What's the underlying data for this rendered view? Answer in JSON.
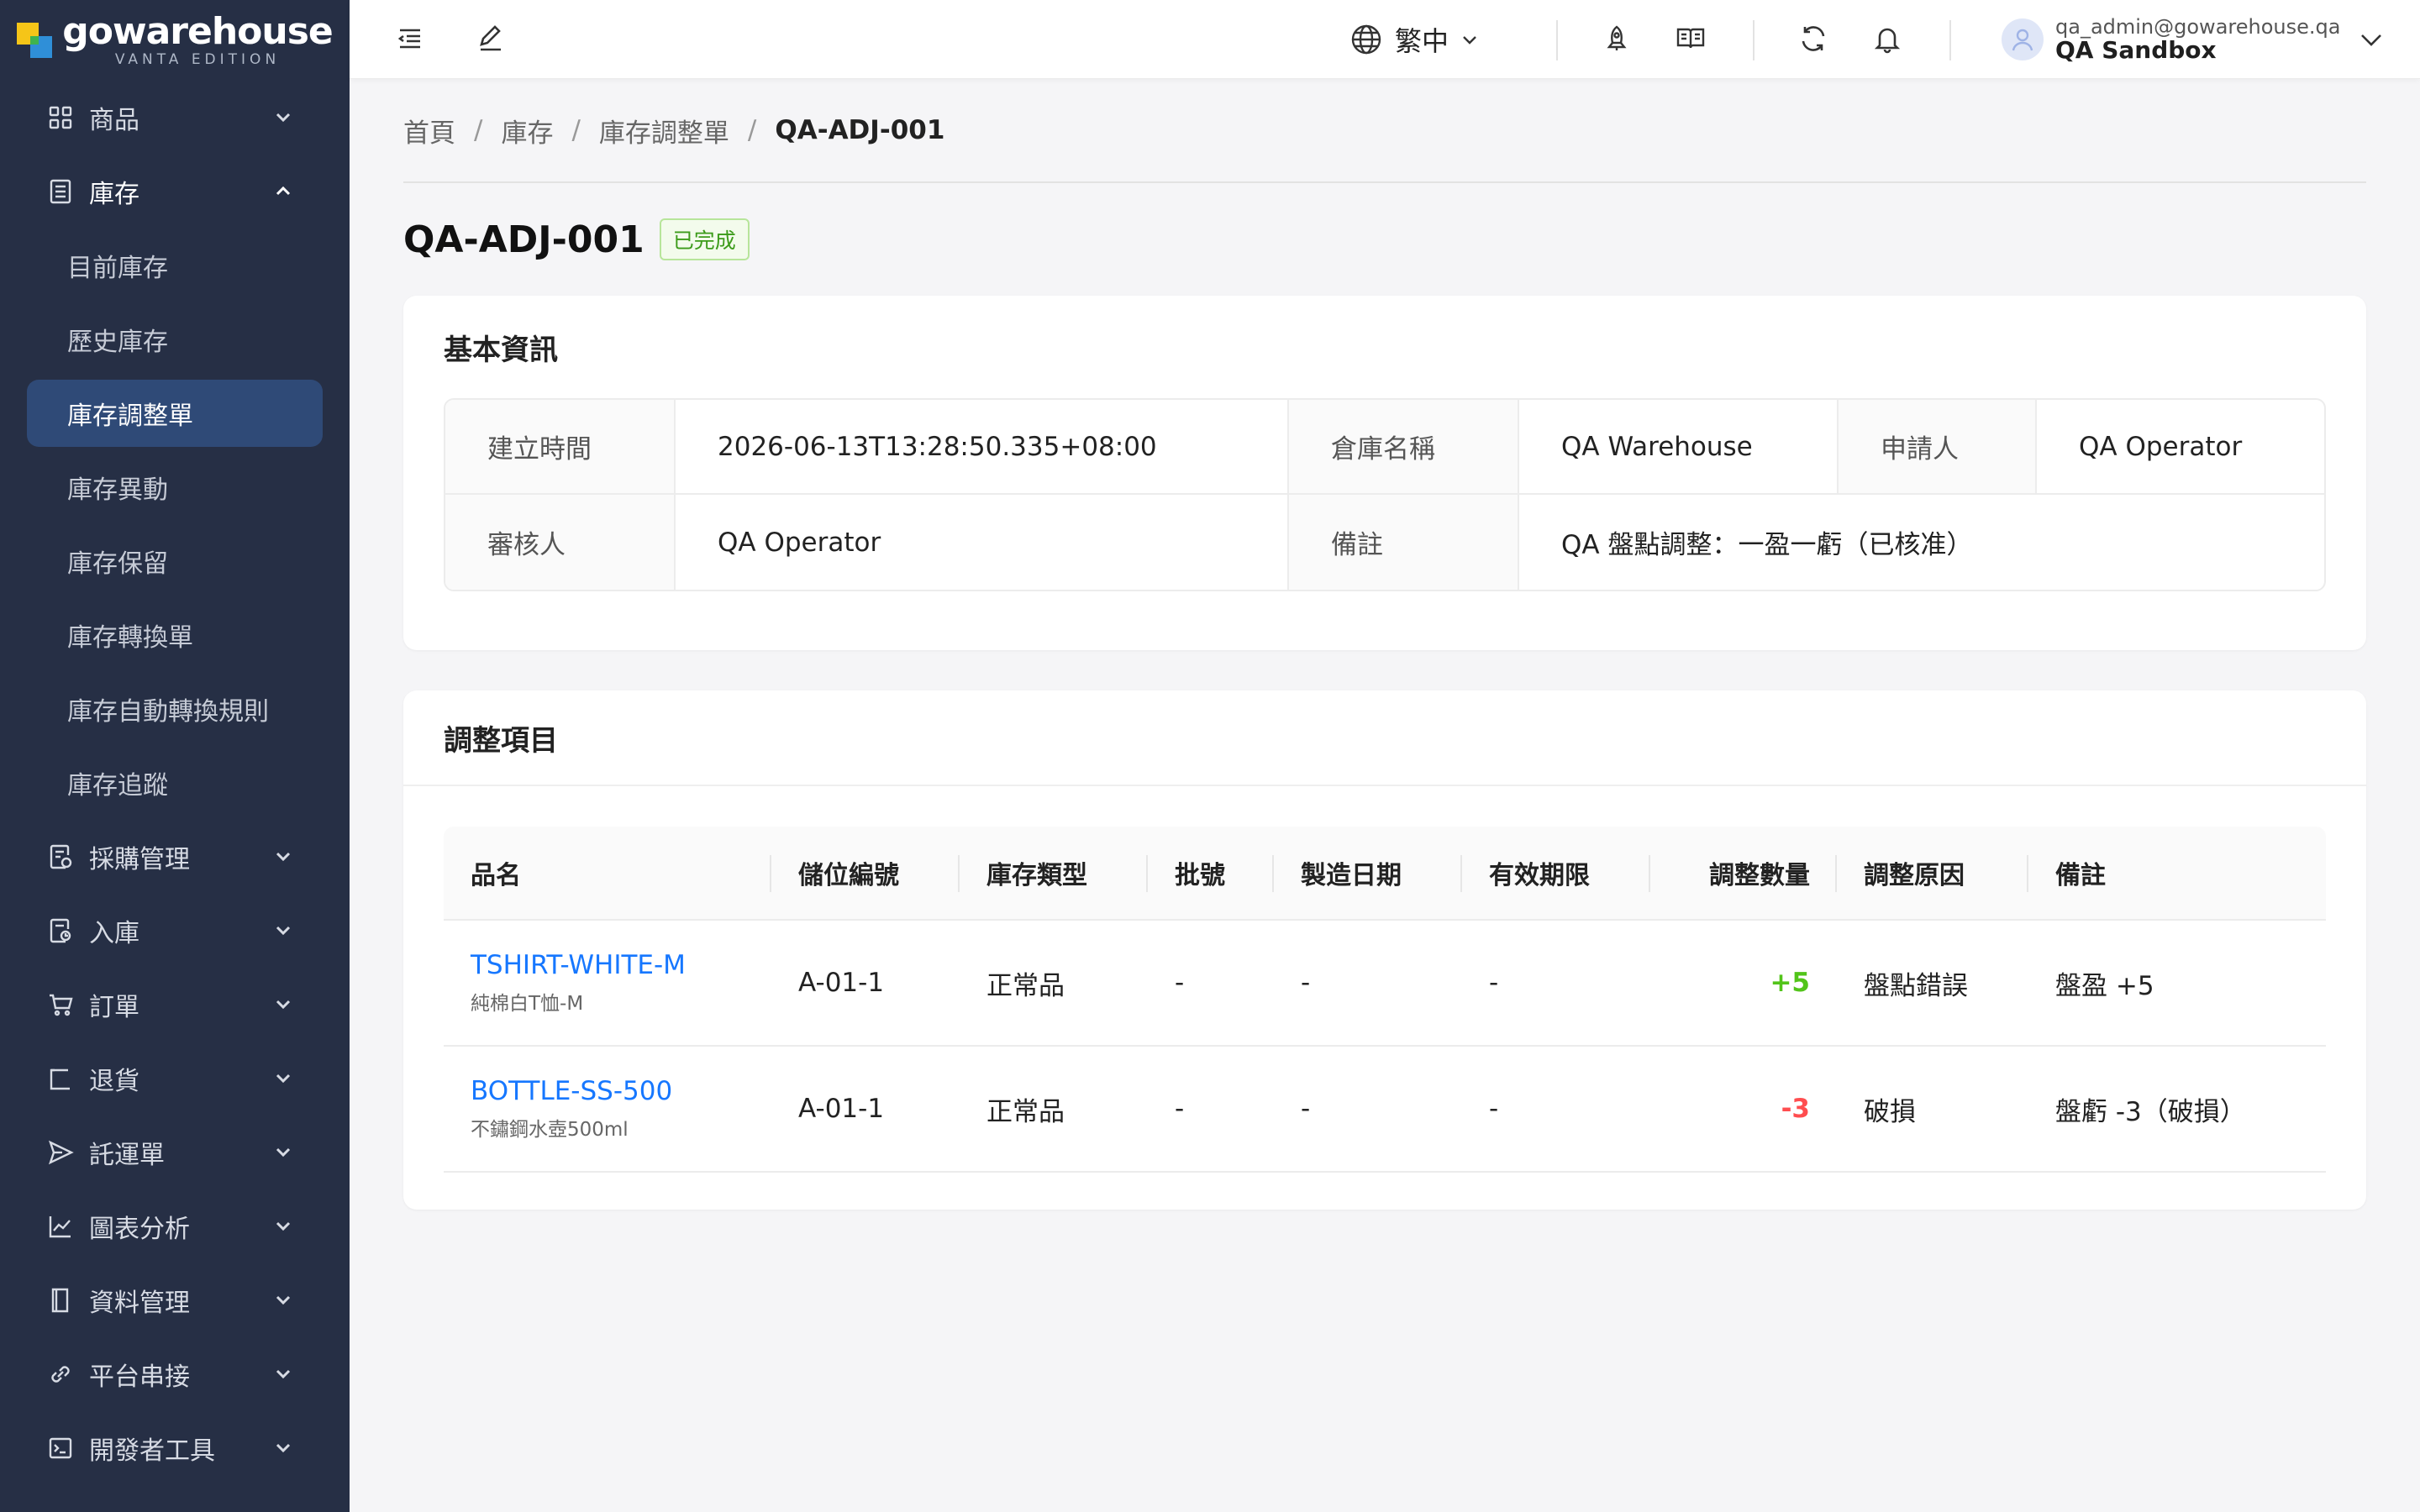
{
  "app": {
    "name": "gowarehouse",
    "edition": "VANTA EDITION"
  },
  "sidebar": {
    "groups": [
      {
        "label": "商品",
        "icon": "grid-icon",
        "open": false
      },
      {
        "label": "庫存",
        "icon": "inventory-icon",
        "open": true
      },
      {
        "label": "採購管理",
        "icon": "purchase-icon",
        "open": false
      },
      {
        "label": "入庫",
        "icon": "inbound-icon",
        "open": false
      },
      {
        "label": "訂單",
        "icon": "cart-icon",
        "open": false
      },
      {
        "label": "退貨",
        "icon": "return-icon",
        "open": false
      },
      {
        "label": "託運單",
        "icon": "send-icon",
        "open": false
      },
      {
        "label": "圖表分析",
        "icon": "chart-icon",
        "open": false
      },
      {
        "label": "資料管理",
        "icon": "book-icon",
        "open": false
      },
      {
        "label": "平台串接",
        "icon": "link-icon",
        "open": false
      },
      {
        "label": "開發者工具",
        "icon": "terminal-icon",
        "open": false
      }
    ],
    "inventory_items": [
      "目前庫存",
      "歷史庫存",
      "庫存調整單",
      "庫存異動",
      "庫存保留",
      "庫存轉換單",
      "庫存自動轉換規則",
      "庫存追蹤"
    ],
    "active_item": "庫存調整單"
  },
  "topbar": {
    "language": "繁中",
    "user_email": "qa_admin@gowarehouse.qa",
    "org": "QA Sandbox",
    "icons": [
      "menu-fold-icon",
      "edit-icon",
      "globe-icon",
      "rocket-icon",
      "read-icon",
      "sync-icon",
      "bell-icon",
      "user-icon"
    ]
  },
  "breadcrumb": [
    "首頁",
    "庫存",
    "庫存調整單",
    "QA-ADJ-001"
  ],
  "page": {
    "title": "QA-ADJ-001",
    "status": "已完成",
    "status_color": "#52c41a"
  },
  "basic_info": {
    "heading": "基本資訊",
    "rows": [
      [
        {
          "label": "建立時間",
          "value": "2026-06-13T13:28:50.335+08:00"
        },
        {
          "label": "倉庫名稱",
          "value": "QA Warehouse"
        },
        {
          "label": "申請人",
          "value": "QA Operator"
        }
      ],
      [
        {
          "label": "審核人",
          "value": "QA Operator"
        },
        {
          "label": "備註",
          "value": "QA 盤點調整：一盈一虧（已核准）"
        }
      ]
    ]
  },
  "items": {
    "heading": "調整項目",
    "columns": [
      "品名",
      "儲位編號",
      "庫存類型",
      "批號",
      "製造日期",
      "有效期限",
      "調整數量",
      "調整原因",
      "備註"
    ],
    "rows": [
      {
        "sku": "TSHIRT-WHITE-M",
        "name": "純棉白T恤-M",
        "location": "A-01-1",
        "type": "正常品",
        "batch": "-",
        "mfg": "-",
        "exp": "-",
        "qty": "+5",
        "reason": "盤點錯誤",
        "note": "盤盈 +5"
      },
      {
        "sku": "BOTTLE-SS-500",
        "name": "不鏽鋼水壺500ml",
        "location": "A-01-1",
        "type": "正常品",
        "batch": "-",
        "mfg": "-",
        "exp": "-",
        "qty": "-3",
        "reason": "破損",
        "note": "盤虧 -3（破損）"
      }
    ]
  },
  "colors": {
    "sidebar_bg": "#262f45",
    "active_bg": "#2f4a77",
    "link": "#1677ff",
    "positive": "#52c41a",
    "negative": "#ff4d4f"
  }
}
